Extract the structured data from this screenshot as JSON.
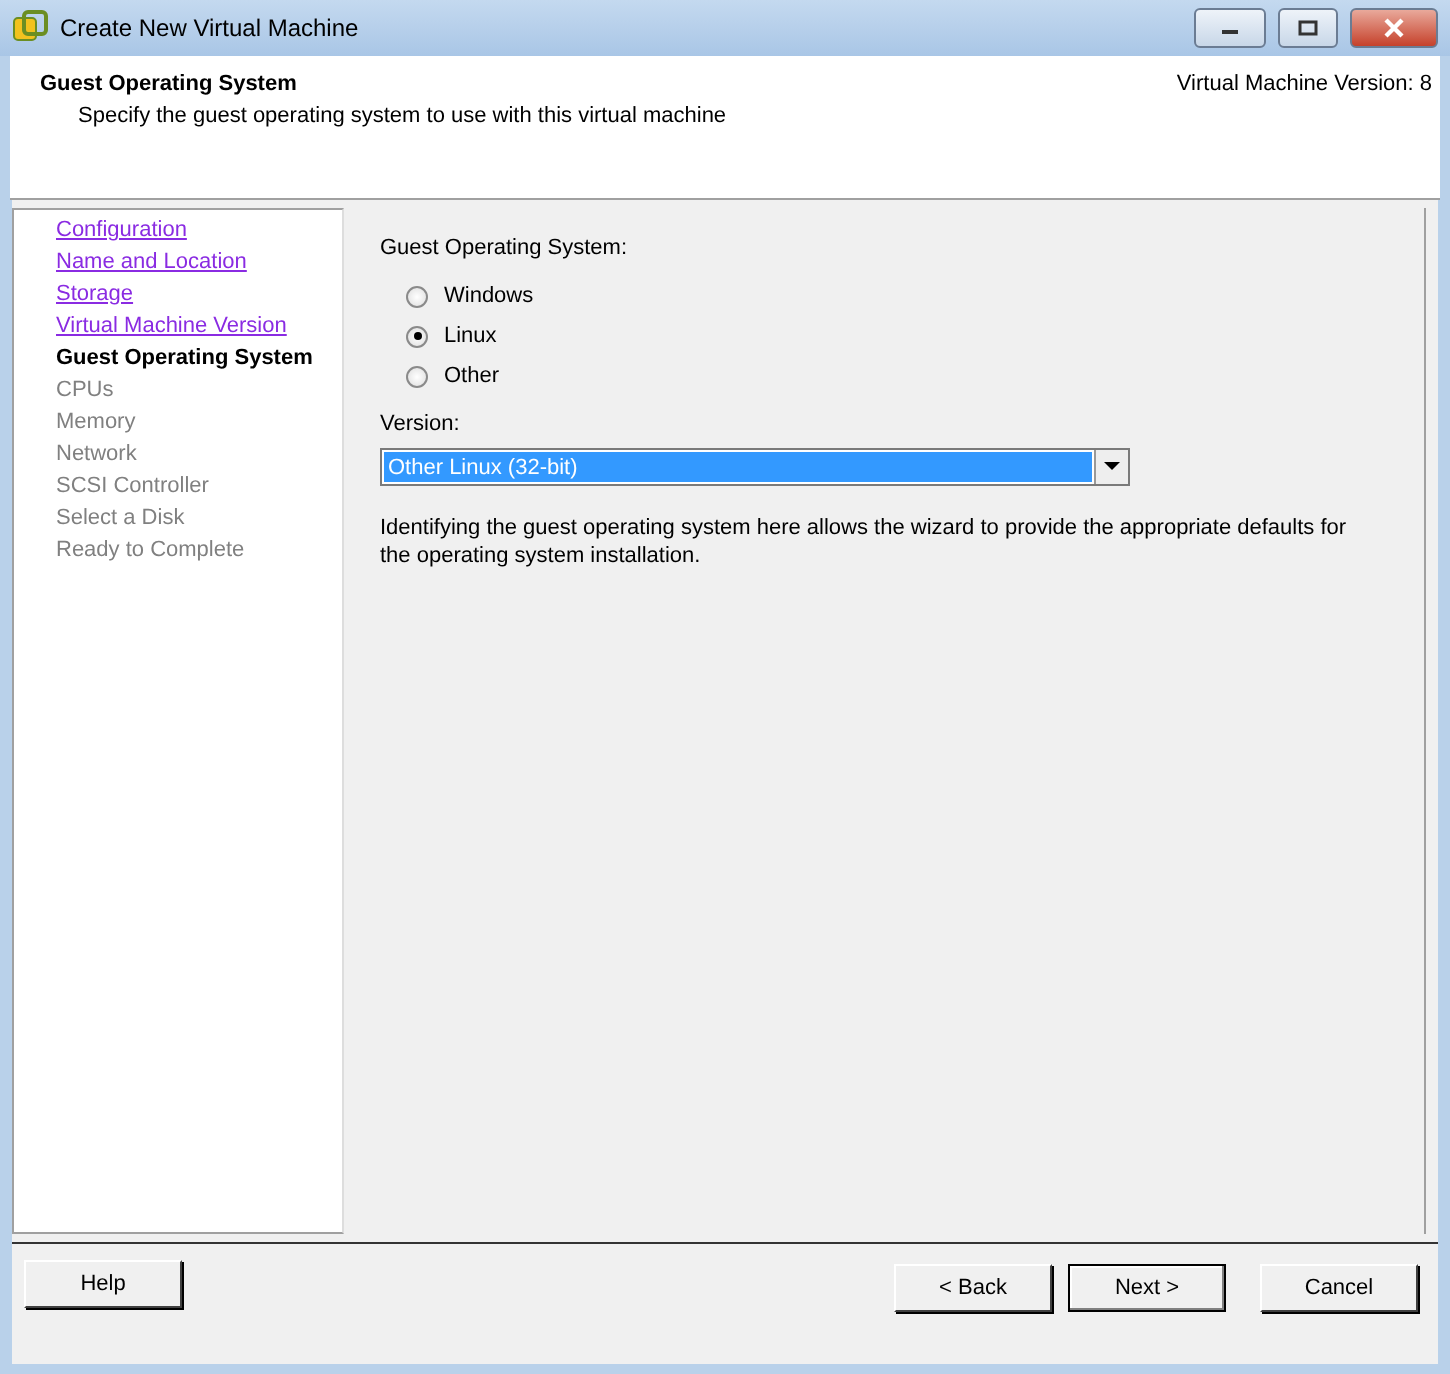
{
  "window": {
    "title": "Create New Virtual Machine"
  },
  "header": {
    "title": "Guest Operating System",
    "subtitle": "Specify the guest operating system to use with this virtual machine",
    "version": "Virtual Machine Version: 8"
  },
  "steps": [
    {
      "label": "Configuration",
      "kind": "done"
    },
    {
      "label": "Name and Location",
      "kind": "done"
    },
    {
      "label": "Storage",
      "kind": "done"
    },
    {
      "label": "Virtual Machine Version",
      "kind": "done"
    },
    {
      "label": "Guest Operating System",
      "kind": "current"
    },
    {
      "label": "CPUs",
      "kind": "pending"
    },
    {
      "label": "Memory",
      "kind": "pending"
    },
    {
      "label": "Network",
      "kind": "pending"
    },
    {
      "label": "SCSI Controller",
      "kind": "pending"
    },
    {
      "label": "Select a Disk",
      "kind": "pending"
    },
    {
      "label": "Ready to Complete",
      "kind": "pending"
    }
  ],
  "os_group": {
    "label": "Guest Operating System:",
    "options": [
      {
        "label": "Windows",
        "selected": false
      },
      {
        "label": "Linux",
        "selected": true
      },
      {
        "label": "Other",
        "selected": false
      }
    ]
  },
  "version": {
    "label": "Version:",
    "value": "Other Linux (32-bit)"
  },
  "info": "Identifying the guest operating system here allows the wizard to provide the appropriate defaults for the operating system installation.",
  "buttons": {
    "help": "Help",
    "back": "< Back",
    "next": "Next >",
    "cancel": "Cancel"
  }
}
